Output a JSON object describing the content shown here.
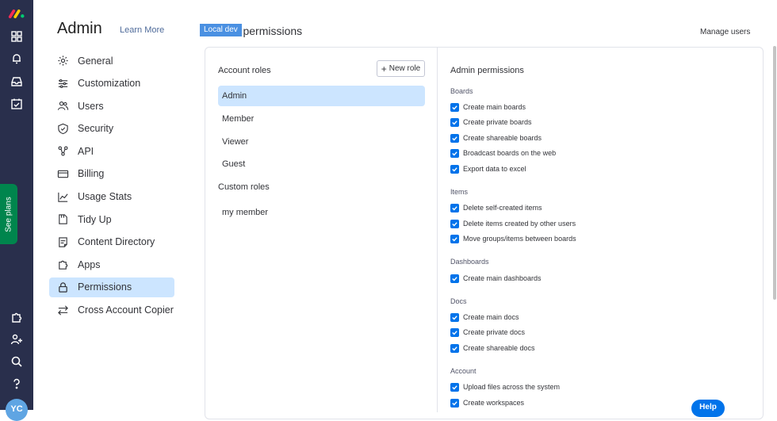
{
  "header": {
    "title": "Admin",
    "learn_more": "Learn More",
    "env_badge": "Local dev",
    "section_title": "Account permissions",
    "manage_users": "Manage users"
  },
  "rail": {
    "see_plans": "See plans",
    "avatar_initials": "YC",
    "icons": [
      "monday-logo-icon",
      "apps-grid-icon",
      "bell-icon",
      "inbox-icon",
      "my-work-icon",
      "puzzle-icon",
      "invite-user-icon",
      "search-icon",
      "help-icon"
    ]
  },
  "nav": {
    "items": [
      {
        "label": "General",
        "icon": "gear-icon"
      },
      {
        "label": "Customization",
        "icon": "sliders-icon"
      },
      {
        "label": "Users",
        "icon": "users-icon"
      },
      {
        "label": "Security",
        "icon": "shield-icon"
      },
      {
        "label": "API",
        "icon": "api-icon"
      },
      {
        "label": "Billing",
        "icon": "card-icon"
      },
      {
        "label": "Usage Stats",
        "icon": "chart-icon"
      },
      {
        "label": "Tidy Up",
        "icon": "tidy-icon"
      },
      {
        "label": "Content Directory",
        "icon": "directory-icon"
      },
      {
        "label": "Apps",
        "icon": "puzzle-icon"
      },
      {
        "label": "Permissions",
        "icon": "lock-icon"
      },
      {
        "label": "Cross Account Copier",
        "icon": "arrows-icon"
      }
    ],
    "active": "Permissions"
  },
  "roles": {
    "heading": "Account roles",
    "new_role": "New role",
    "items": [
      "Admin",
      "Member",
      "Viewer",
      "Guest"
    ],
    "selected": "Admin",
    "custom_heading": "Custom roles",
    "custom_items": [
      "my member"
    ]
  },
  "permissions": {
    "heading": "Admin permissions",
    "groups": [
      {
        "label": "Boards",
        "items": [
          "Create main boards",
          "Create private boards",
          "Create shareable boards",
          "Broadcast boards on the web",
          "Export data to excel"
        ]
      },
      {
        "label": "Items",
        "items": [
          "Delete self-created items",
          "Delete items created by other users",
          "Move groups/items between boards"
        ]
      },
      {
        "label": "Dashboards",
        "items": [
          "Create main dashboards"
        ]
      },
      {
        "label": "Docs",
        "items": [
          "Create main docs",
          "Create private docs",
          "Create shareable docs"
        ]
      },
      {
        "label": "Account",
        "items": [
          "Upload files across the system",
          "Create workspaces"
        ]
      }
    ]
  },
  "help_button": "Help",
  "colors": {
    "rail_bg": "#292f4c",
    "accent": "#0073ea",
    "selected_bg": "#cce5ff",
    "see_plans_bg": "#00854d"
  }
}
